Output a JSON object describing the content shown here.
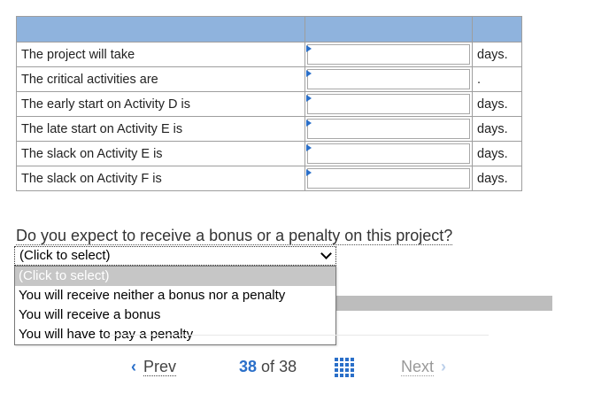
{
  "table": {
    "rows": [
      {
        "label": "The project will take",
        "unit": "days."
      },
      {
        "label": "The critical activities are",
        "unit": "."
      },
      {
        "label": "The early start on Activity D is",
        "unit": "days."
      },
      {
        "label": "The late start on Activity E is",
        "unit": "days."
      },
      {
        "label": "The slack on Activity E is",
        "unit": "days."
      },
      {
        "label": "The slack on Activity F is",
        "unit": "days."
      }
    ]
  },
  "question": {
    "text": "Do you expect to receive a bonus or a penalty on this project?",
    "select_value": "(Click to select)",
    "options": [
      "(Click to select)",
      "You will receive neither a bonus nor a penalty",
      "You will receive a bonus",
      "You will have to pay a penalty"
    ]
  },
  "nav": {
    "prev_label": "Prev",
    "current_page": "38",
    "of_label": "of",
    "total_pages": "38",
    "next_label": "Next"
  },
  "colors": {
    "header_bg": "#8fb3dd",
    "accent": "#2a6fc9"
  }
}
